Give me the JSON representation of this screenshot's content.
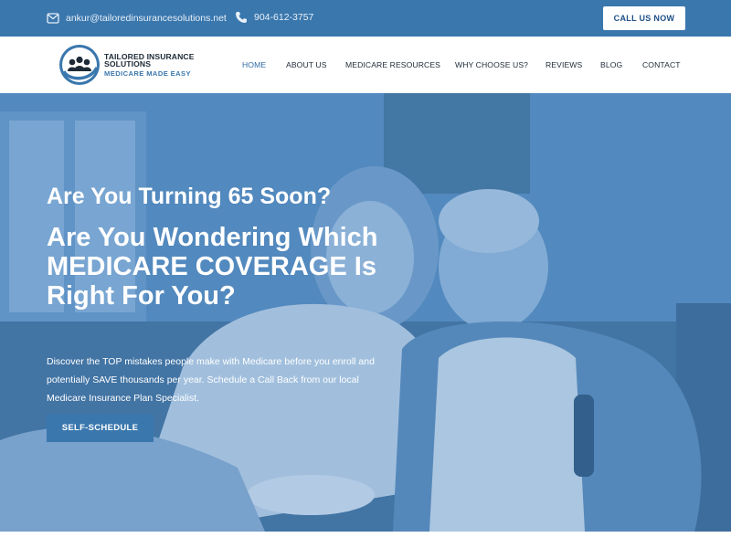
{
  "topbar": {
    "email": "ankur@tailoredinsurancesolutions.net",
    "phone": "904-612-3757",
    "call_button": "CALL US NOW",
    "email_icon": "envelope-icon",
    "phone_icon": "phone-icon"
  },
  "header": {
    "logo": {
      "name_line1": "TAILORED INSURANCE",
      "name_line2": "SOLUTIONS",
      "tagline": "MEDICARE MADE EASY"
    },
    "nav": [
      {
        "label": "HOME",
        "active": true
      },
      {
        "label": "ABOUT US",
        "active": false
      },
      {
        "label": "MEDICARE RESOURCES",
        "active": false
      },
      {
        "label": "WHY CHOOSE US?",
        "active": false
      },
      {
        "label": "REVIEWS",
        "active": false
      },
      {
        "label": "BLOG",
        "active": false
      },
      {
        "label": "CONTACT",
        "active": false
      }
    ]
  },
  "hero": {
    "subheading": "Are You Turning 65 Soon?",
    "heading": "Are You Wondering Which MEDICARE COVERAGE Is Right For You?",
    "body": "Discover the TOP mistakes people make with Medicare before you enroll and potentially SAVE thousands per year. Schedule a Call Back from our local Medicare Insurance Plan Specialist.",
    "cta": "SELF-SCHEDULE"
  },
  "colors": {
    "brand_blue": "#3a77ad",
    "nav_active": "#2f6aa6",
    "text_dark": "#1d2a36"
  }
}
